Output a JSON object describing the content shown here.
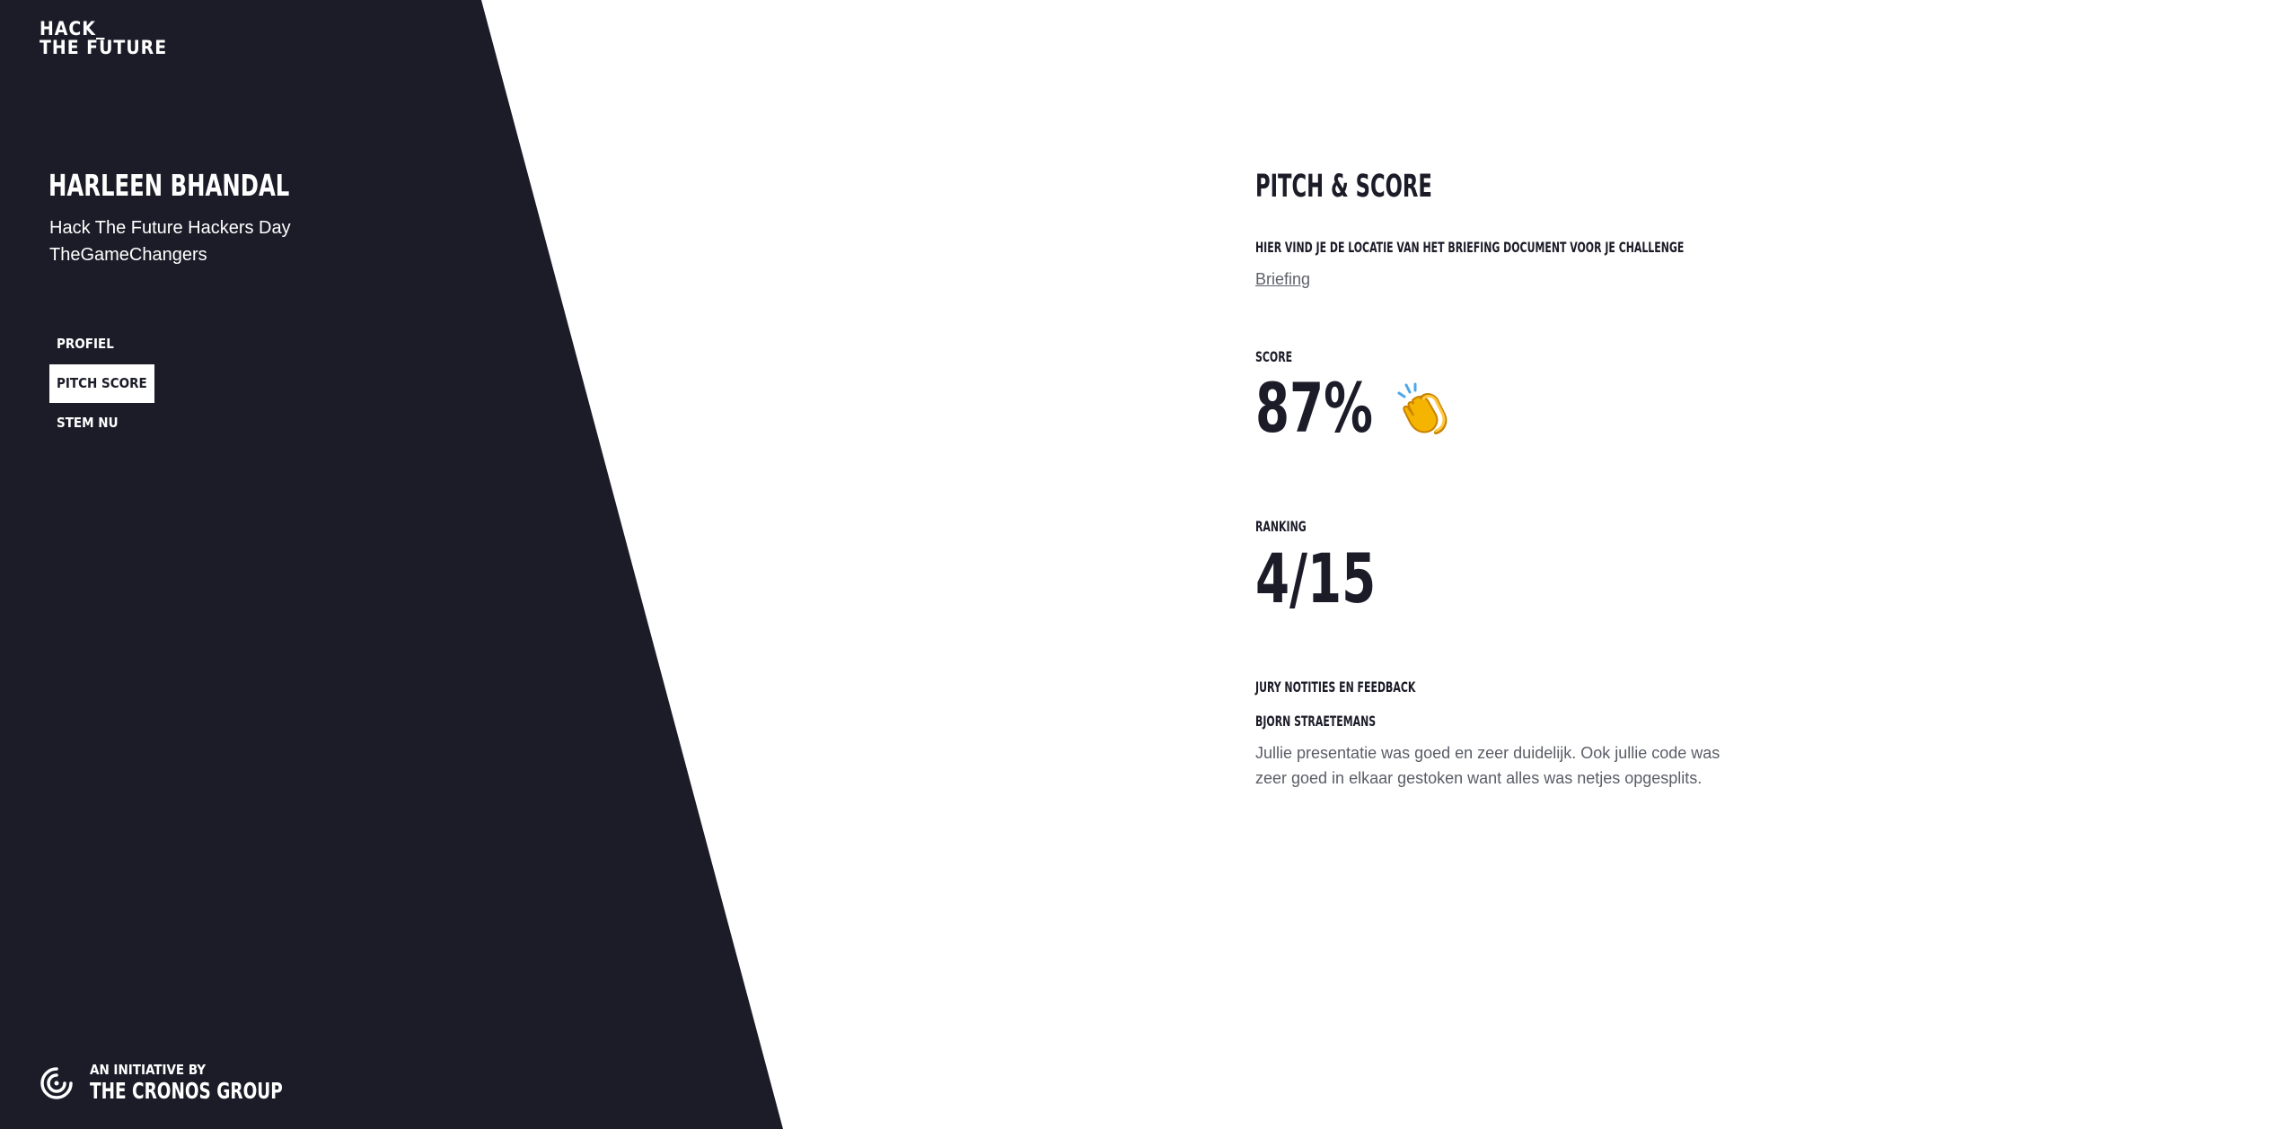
{
  "logo": {
    "line1": "HACK_",
    "line2": "THE FUTURE"
  },
  "profile": {
    "name": "HARLEEN BHANDAL",
    "event": "Hack The Future Hackers Day",
    "team": "TheGameChangers"
  },
  "nav": {
    "items": [
      {
        "label": "PROFIEL",
        "active": false
      },
      {
        "label": "PITCH SCORE",
        "active": true
      },
      {
        "label": "STEM NU",
        "active": false
      }
    ]
  },
  "initiative": {
    "small_label": "AN INITIATIVE BY",
    "big_label": "THE CRONOS GROUP"
  },
  "main": {
    "title": "PITCH & SCORE",
    "briefing_label": "HIER VIND JE DE LOCATIE VAN HET BRIEFING DOCUMENT VOOR JE CHALLENGE",
    "briefing_link": "Briefing",
    "score_label": "SCORE",
    "score_value": "87%",
    "ranking_label": "RANKING",
    "ranking_value": "4/15",
    "feedback_label": "JURY NOTITIES EN FEEDBACK",
    "jury_name": "BJORN STRAETEMANS",
    "feedback_text": "Jullie presentatie was goed en zeer duidelijk. Ook jullie code was zeer goed in elkaar gestoken want alles was netjes opgesplits."
  },
  "icons": {
    "clap": "clapping-hands-icon",
    "initiative": "cronos-logo-icon"
  },
  "colors": {
    "sidebar": "#1c1c29",
    "text_dark": "#1c1c29",
    "body_text": "#5a5d66",
    "active_nav_bg": "#ffffff",
    "clap_yellow": "#f4b400"
  }
}
